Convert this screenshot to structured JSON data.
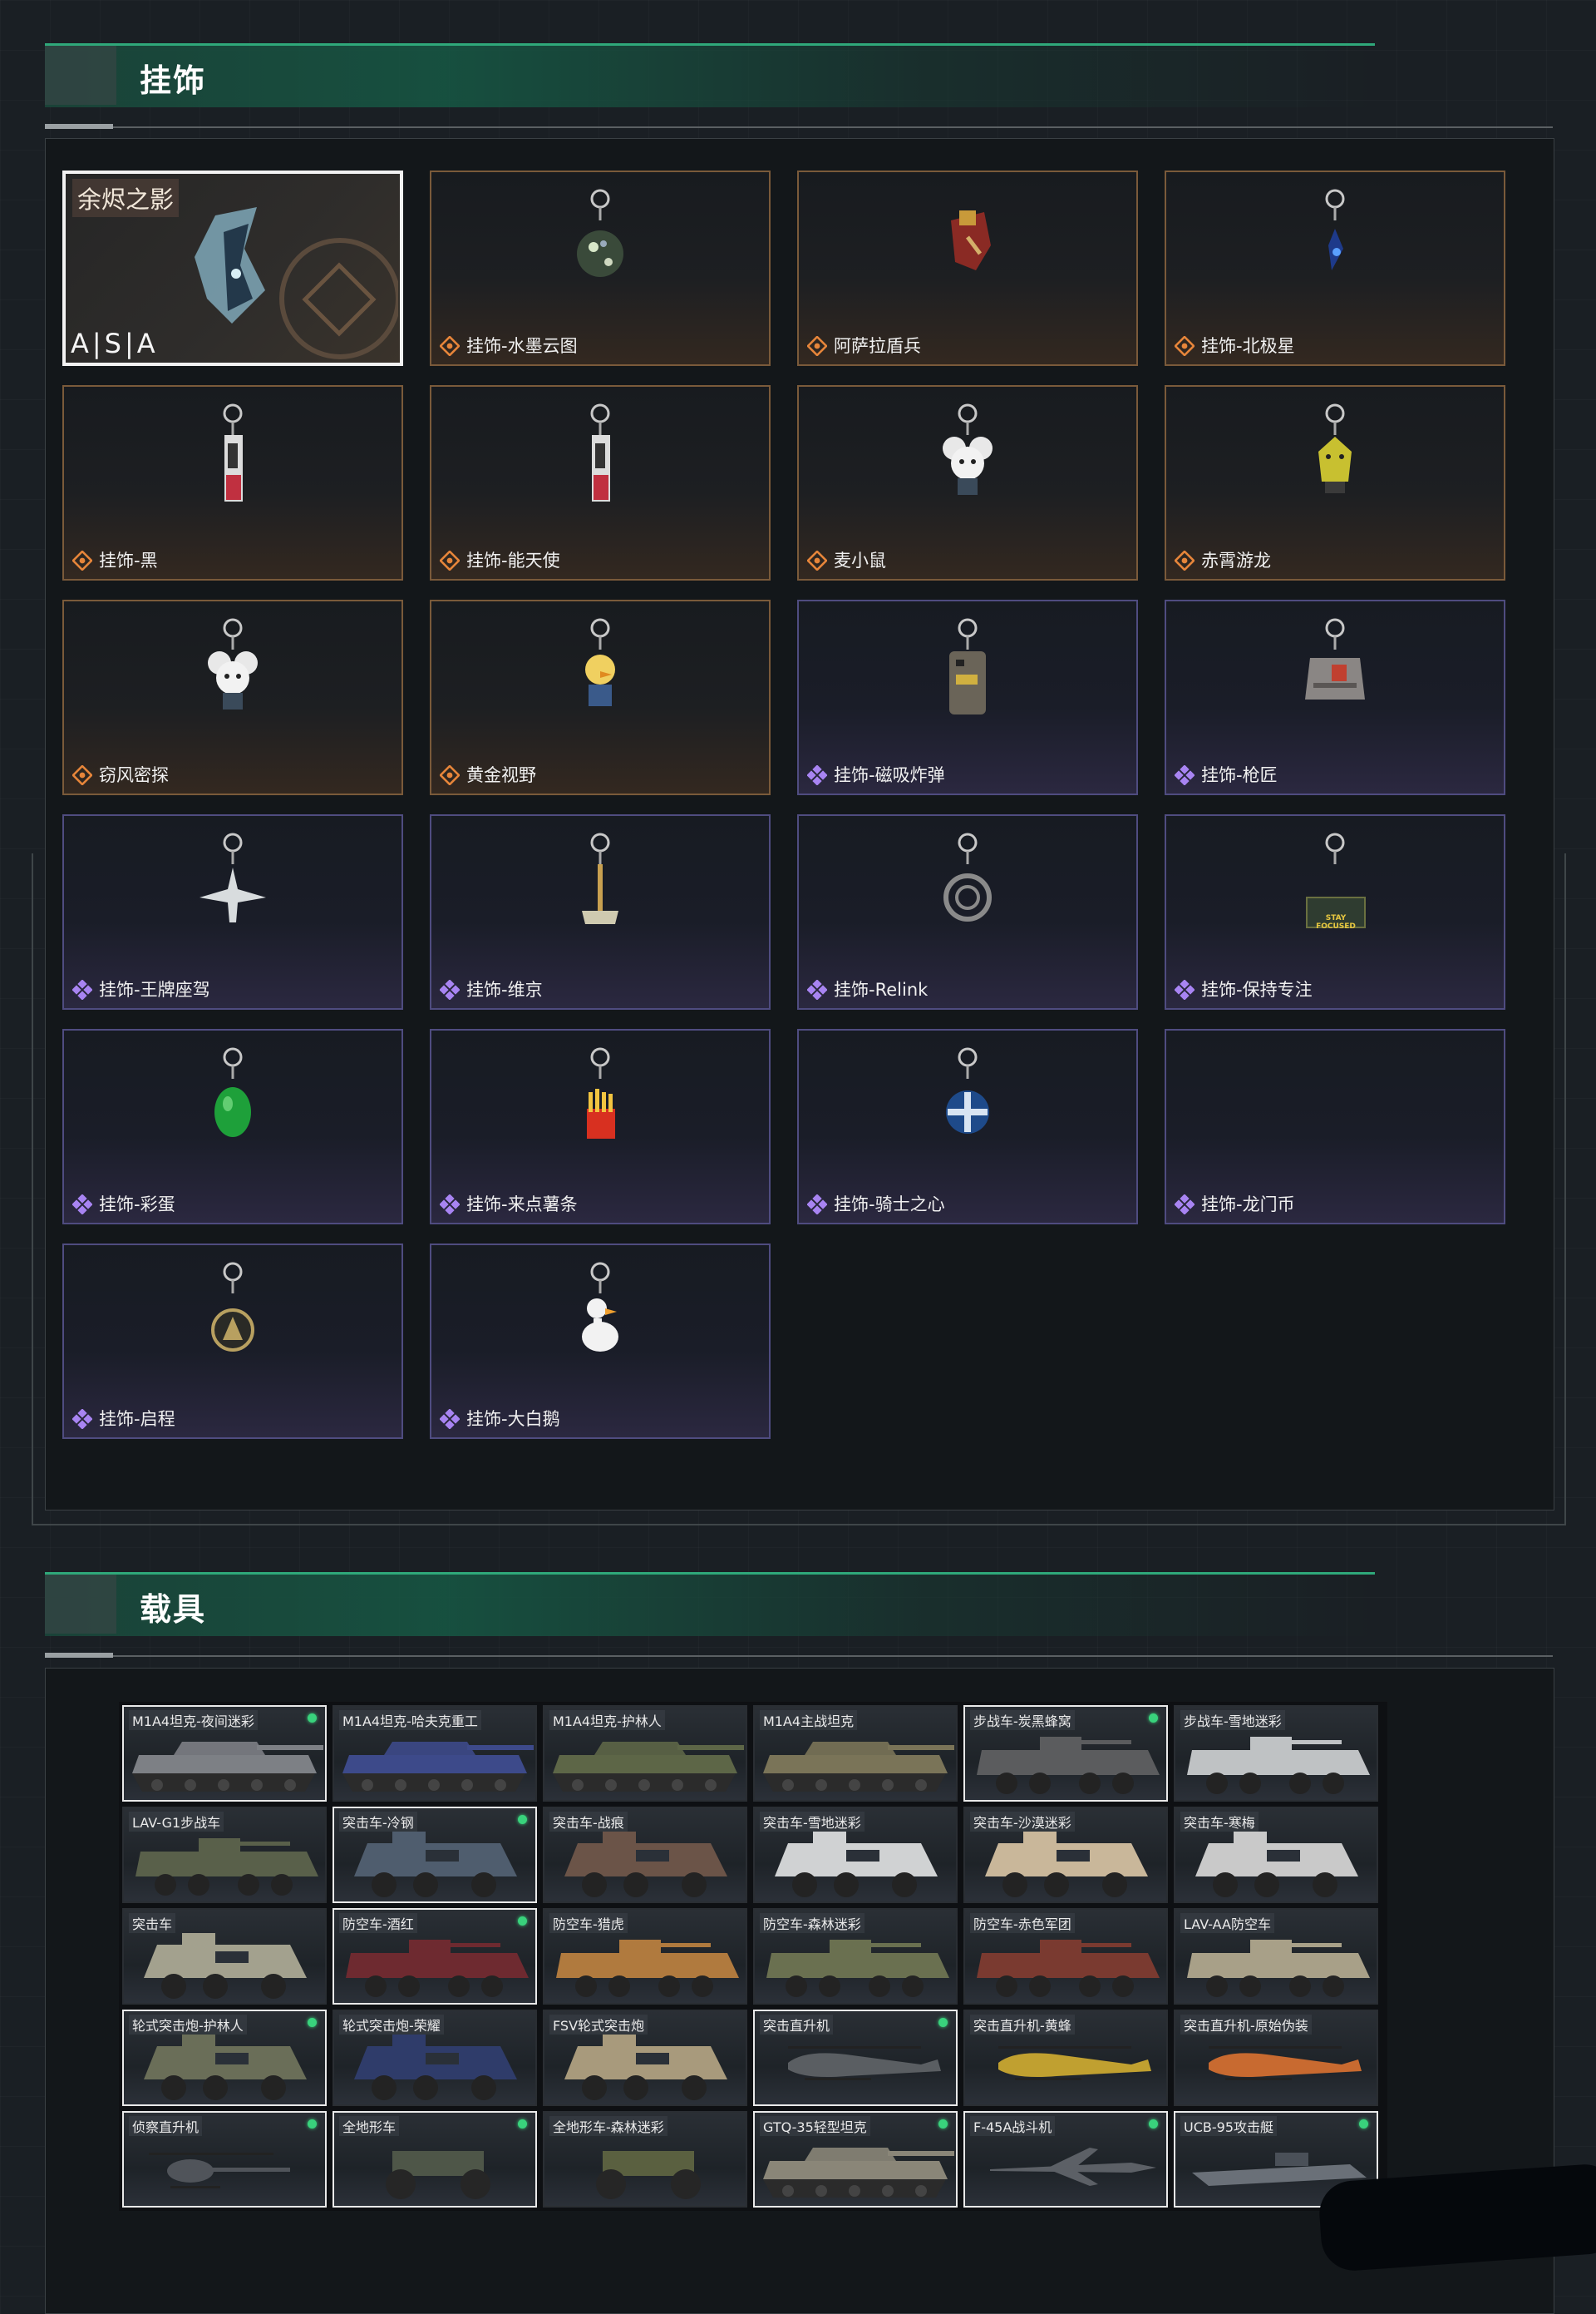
{
  "sections": {
    "charms": {
      "title": "挂饰"
    },
    "vehicles": {
      "title": "载具"
    }
  },
  "featured_charm": {
    "title": "余烬之影",
    "logo": "A|S|A"
  },
  "charms": [
    {
      "label": "挂饰-水墨云图",
      "rarity": "gold",
      "icon": "orb-charm-icon"
    },
    {
      "label": "阿萨拉盾兵",
      "rarity": "gold",
      "icon": "shield-soldier-charm-icon"
    },
    {
      "label": "挂饰-北极星",
      "rarity": "gold",
      "icon": "star-charm-icon"
    },
    {
      "label": "挂饰-黑",
      "rarity": "gold",
      "icon": "card-charm-icon"
    },
    {
      "label": "挂饰-能天使",
      "rarity": "gold",
      "icon": "card-charm-icon"
    },
    {
      "label": "麦小鼠",
      "rarity": "gold",
      "icon": "mouse-charm-icon"
    },
    {
      "label": "赤霄游龙",
      "rarity": "gold",
      "icon": "dragon-charm-icon"
    },
    {
      "label": "窃风密探",
      "rarity": "gold",
      "icon": "mouse-charm-icon"
    },
    {
      "label": "黄金视野",
      "rarity": "gold",
      "icon": "duck-charm-icon"
    },
    {
      "label": "挂饰-磁吸炸弹",
      "rarity": "purple",
      "icon": "bomb-charm-icon"
    },
    {
      "label": "挂饰-枪匠",
      "rarity": "purple",
      "icon": "box-charm-icon"
    },
    {
      "label": "挂饰-王牌座驾",
      "rarity": "purple",
      "icon": "jet-charm-icon"
    },
    {
      "label": "挂饰-维京",
      "rarity": "purple",
      "icon": "hammer-charm-icon"
    },
    {
      "label": "挂饰-Relink",
      "rarity": "purple",
      "icon": "relink-charm-icon"
    },
    {
      "label": "挂饰-保持专注",
      "rarity": "purple",
      "icon": "sign-charm-icon"
    },
    {
      "label": "挂饰-彩蛋",
      "rarity": "purple",
      "icon": "egg-charm-icon"
    },
    {
      "label": "挂饰-来点薯条",
      "rarity": "purple",
      "icon": "fries-charm-icon"
    },
    {
      "label": "挂饰-骑士之心",
      "rarity": "purple",
      "icon": "knight-charm-icon"
    },
    {
      "label": "挂饰-龙门币",
      "rarity": "purple",
      "icon": "coin-charm-icon"
    },
    {
      "label": "挂饰-启程",
      "rarity": "purple",
      "icon": "medal-charm-icon"
    },
    {
      "label": "挂饰-大白鹅",
      "rarity": "purple",
      "icon": "goose-charm-icon"
    }
  ],
  "charm_sign_text": "STAY FOCUSED",
  "vehicles": [
    {
      "name": "M1A4坦克-夜间迷彩",
      "selected": true,
      "owned": true,
      "kind": "tank",
      "color": "#7d8085"
    },
    {
      "name": "M1A4坦克-哈夫克重工",
      "selected": false,
      "owned": false,
      "kind": "tank",
      "color": "#3d4a8a"
    },
    {
      "name": "M1A4坦克-护林人",
      "selected": false,
      "owned": false,
      "kind": "tank",
      "color": "#5d6647"
    },
    {
      "name": "M1A4主战坦克",
      "selected": false,
      "owned": false,
      "kind": "tank",
      "color": "#7a7458"
    },
    {
      "name": "步战车-炭黑蜂窝",
      "selected": true,
      "owned": true,
      "kind": "ifv",
      "color": "#5b5c5e"
    },
    {
      "name": "步战车-雪地迷彩",
      "selected": false,
      "owned": false,
      "kind": "ifv",
      "color": "#bfc2c4"
    },
    {
      "name": "LAV-G1步战车",
      "selected": false,
      "owned": false,
      "kind": "ifv",
      "color": "#59604a"
    },
    {
      "name": "突击车-冷钢",
      "selected": true,
      "owned": true,
      "kind": "apc",
      "color": "#4f5d6e"
    },
    {
      "name": "突击车-战痕",
      "selected": false,
      "owned": false,
      "kind": "apc",
      "color": "#6b5448"
    },
    {
      "name": "突击车-雪地迷彩",
      "selected": false,
      "owned": false,
      "kind": "apc",
      "color": "#d0d2d3"
    },
    {
      "name": "突击车-沙漠迷彩",
      "selected": false,
      "owned": false,
      "kind": "apc",
      "color": "#c9b79a"
    },
    {
      "name": "突击车-寒梅",
      "selected": false,
      "owned": false,
      "kind": "apc",
      "color": "#c9c9c9"
    },
    {
      "name": "突击车",
      "selected": false,
      "owned": false,
      "kind": "apc",
      "color": "#a3a18e"
    },
    {
      "name": "防空车-酒红",
      "selected": true,
      "owned": true,
      "kind": "ifv",
      "color": "#6e2a30"
    },
    {
      "name": "防空车-猎虎",
      "selected": false,
      "owned": false,
      "kind": "ifv",
      "color": "#b07a3e"
    },
    {
      "name": "防空车-森林迷彩",
      "selected": false,
      "owned": false,
      "kind": "ifv",
      "color": "#6a7050"
    },
    {
      "name": "防空车-赤色军团",
      "selected": false,
      "owned": false,
      "kind": "ifv",
      "color": "#7a3a30"
    },
    {
      "name": "LAV-AA防空车",
      "selected": false,
      "owned": false,
      "kind": "ifv",
      "color": "#a8a088"
    },
    {
      "name": "轮式突击炮-护林人",
      "selected": true,
      "owned": true,
      "kind": "apc",
      "color": "#6a6e58"
    },
    {
      "name": "轮式突击炮-荣耀",
      "selected": false,
      "owned": false,
      "kind": "apc",
      "color": "#2f3c6a"
    },
    {
      "name": "FSV轮式突击炮",
      "selected": false,
      "owned": false,
      "kind": "apc",
      "color": "#a89a7c"
    },
    {
      "name": "突击直升机",
      "selected": true,
      "owned": true,
      "kind": "heli",
      "color": "#5a5e62"
    },
    {
      "name": "突击直升机-黄蜂",
      "selected": false,
      "owned": false,
      "kind": "heli",
      "color": "#c0a030"
    },
    {
      "name": "突击直升机-原始伪装",
      "selected": false,
      "owned": false,
      "kind": "heli",
      "color": "#c86a30"
    },
    {
      "name": "侦察直升机",
      "selected": true,
      "owned": true,
      "kind": "scout",
      "color": "#50545a"
    },
    {
      "name": "全地形车",
      "selected": true,
      "owned": true,
      "kind": "atv",
      "color": "#4e5648"
    },
    {
      "name": "全地形车-森林迷彩",
      "selected": false,
      "owned": false,
      "kind": "atv",
      "color": "#5a6040"
    },
    {
      "name": "GTQ-35轻型坦克",
      "selected": true,
      "owned": true,
      "kind": "tank",
      "color": "#8a8678"
    },
    {
      "name": "F-45A战斗机",
      "selected": true,
      "owned": true,
      "kind": "jet",
      "color": "#5c6066"
    },
    {
      "name": "UCB-95攻击艇",
      "selected": true,
      "owned": true,
      "kind": "boat",
      "color": "#6a7078"
    }
  ]
}
